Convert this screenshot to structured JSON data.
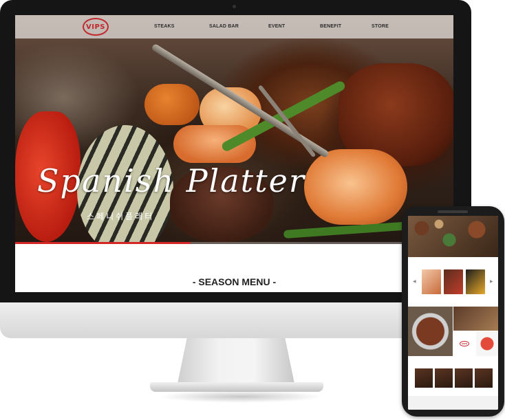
{
  "brand": {
    "logo_text": "VIPS"
  },
  "nav": {
    "items": [
      "STEAKS",
      "SALAD BAR",
      "EVENT",
      "BENEFIT",
      "STORE"
    ]
  },
  "hero": {
    "title": "Spanish Platter",
    "subtitle": "스페니쉬플래터",
    "slide_progress": 0.4
  },
  "season": {
    "title": "- SEASON MENU -"
  },
  "colors": {
    "brand_red": "#c1272d",
    "progress_red": "#d3282a",
    "nav_text": "#2a2a2a"
  }
}
